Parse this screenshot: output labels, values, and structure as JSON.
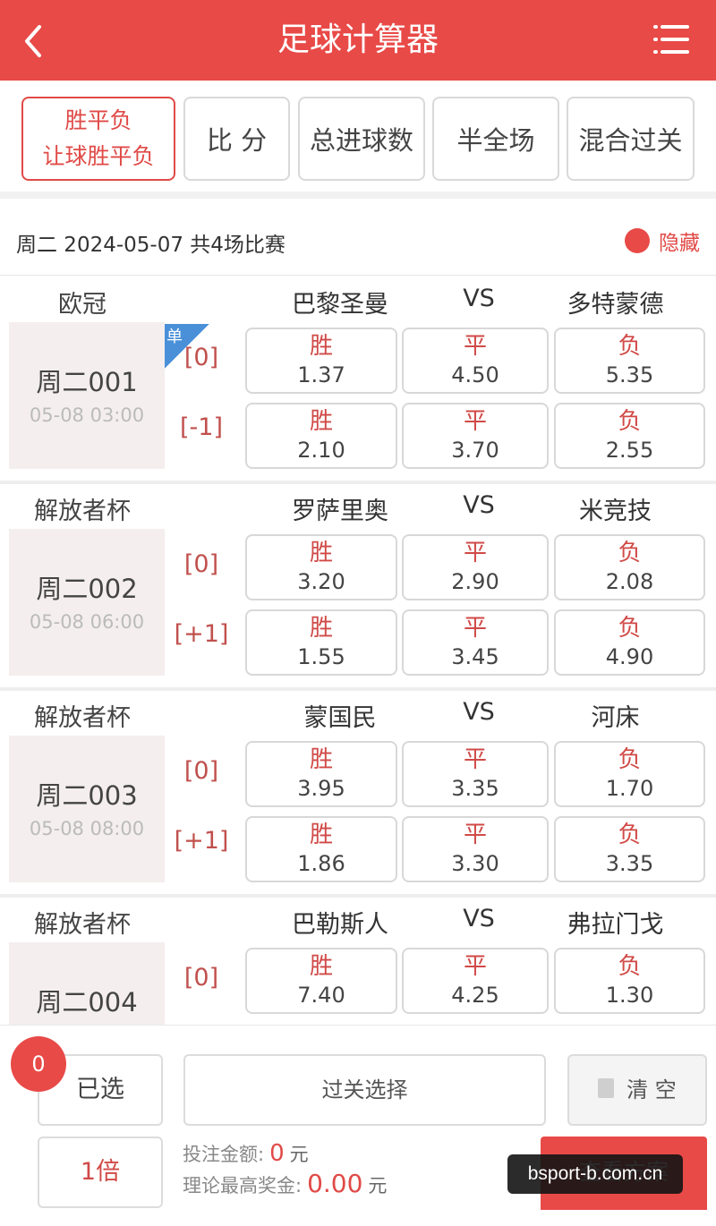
{
  "header": {
    "back_icon": "chevron-left-icon",
    "title": "足球计算器",
    "menu_icon": "menu-icon"
  },
  "tabs": [
    {
      "label_line1": "胜平负",
      "label_line2": "让球胜平负",
      "active": true
    },
    {
      "label": "比 分"
    },
    {
      "label": "总进球数"
    },
    {
      "label": "半全场"
    },
    {
      "label": "混合过关"
    }
  ],
  "info": {
    "date_text": "周二 2024-05-07 共4场比赛",
    "hide_label": "隐藏",
    "accent": "#e84a47"
  },
  "matches": [
    {
      "league": "欧冠",
      "home": "巴黎圣曼",
      "vs": "VS",
      "away": "多特蒙德",
      "id": "周二001",
      "time": "05-08 03:00",
      "single_tag": "单",
      "rows": [
        {
          "handicap": "[0]",
          "odds": [
            {
              "label": "胜",
              "value": "1.37"
            },
            {
              "label": "平",
              "value": "4.50"
            },
            {
              "label": "负",
              "value": "5.35"
            }
          ]
        },
        {
          "handicap": "[-1]",
          "odds": [
            {
              "label": "胜",
              "value": "2.10"
            },
            {
              "label": "平",
              "value": "3.70"
            },
            {
              "label": "负",
              "value": "2.55"
            }
          ]
        }
      ]
    },
    {
      "league": "解放者杯",
      "home": "罗萨里奥",
      "vs": "VS",
      "away": "米竞技",
      "id": "周二002",
      "time": "05-08 06:00",
      "rows": [
        {
          "handicap": "[0]",
          "odds": [
            {
              "label": "胜",
              "value": "3.20"
            },
            {
              "label": "平",
              "value": "2.90"
            },
            {
              "label": "负",
              "value": "2.08"
            }
          ]
        },
        {
          "handicap": "[+1]",
          "odds": [
            {
              "label": "胜",
              "value": "1.55"
            },
            {
              "label": "平",
              "value": "3.45"
            },
            {
              "label": "负",
              "value": "4.90"
            }
          ]
        }
      ]
    },
    {
      "league": "解放者杯",
      "home": "蒙国民",
      "vs": "VS",
      "away": "河床",
      "id": "周二003",
      "time": "05-08 08:00",
      "rows": [
        {
          "handicap": "[0]",
          "odds": [
            {
              "label": "胜",
              "value": "3.95"
            },
            {
              "label": "平",
              "value": "3.35"
            },
            {
              "label": "负",
              "value": "1.70"
            }
          ]
        },
        {
          "handicap": "[+1]",
          "odds": [
            {
              "label": "胜",
              "value": "1.86"
            },
            {
              "label": "平",
              "value": "3.30"
            },
            {
              "label": "负",
              "value": "3.35"
            }
          ]
        }
      ]
    },
    {
      "league": "解放者杯",
      "home": "巴勒斯人",
      "vs": "VS",
      "away": "弗拉门戈",
      "id": "周二004",
      "rows": [
        {
          "handicap": "[0]",
          "odds": [
            {
              "label": "胜",
              "value": "7.40"
            },
            {
              "label": "平",
              "value": "4.25"
            },
            {
              "label": "负",
              "value": "1.30"
            }
          ]
        }
      ]
    }
  ],
  "bottom": {
    "count": "0",
    "selected_label": "已选",
    "pass_label": "过关选择",
    "clear_label": "清 空",
    "clear_icon": "trash-icon",
    "multiplier_label": "1倍",
    "bet_label": "投注金额:",
    "bet_value": "0",
    "bet_unit": "元",
    "prize_label": "理论最高奖金:",
    "prize_value": "0.00",
    "prize_unit": "元",
    "view_label": "查看方案"
  },
  "watermark": "bsport-b.com.cn"
}
